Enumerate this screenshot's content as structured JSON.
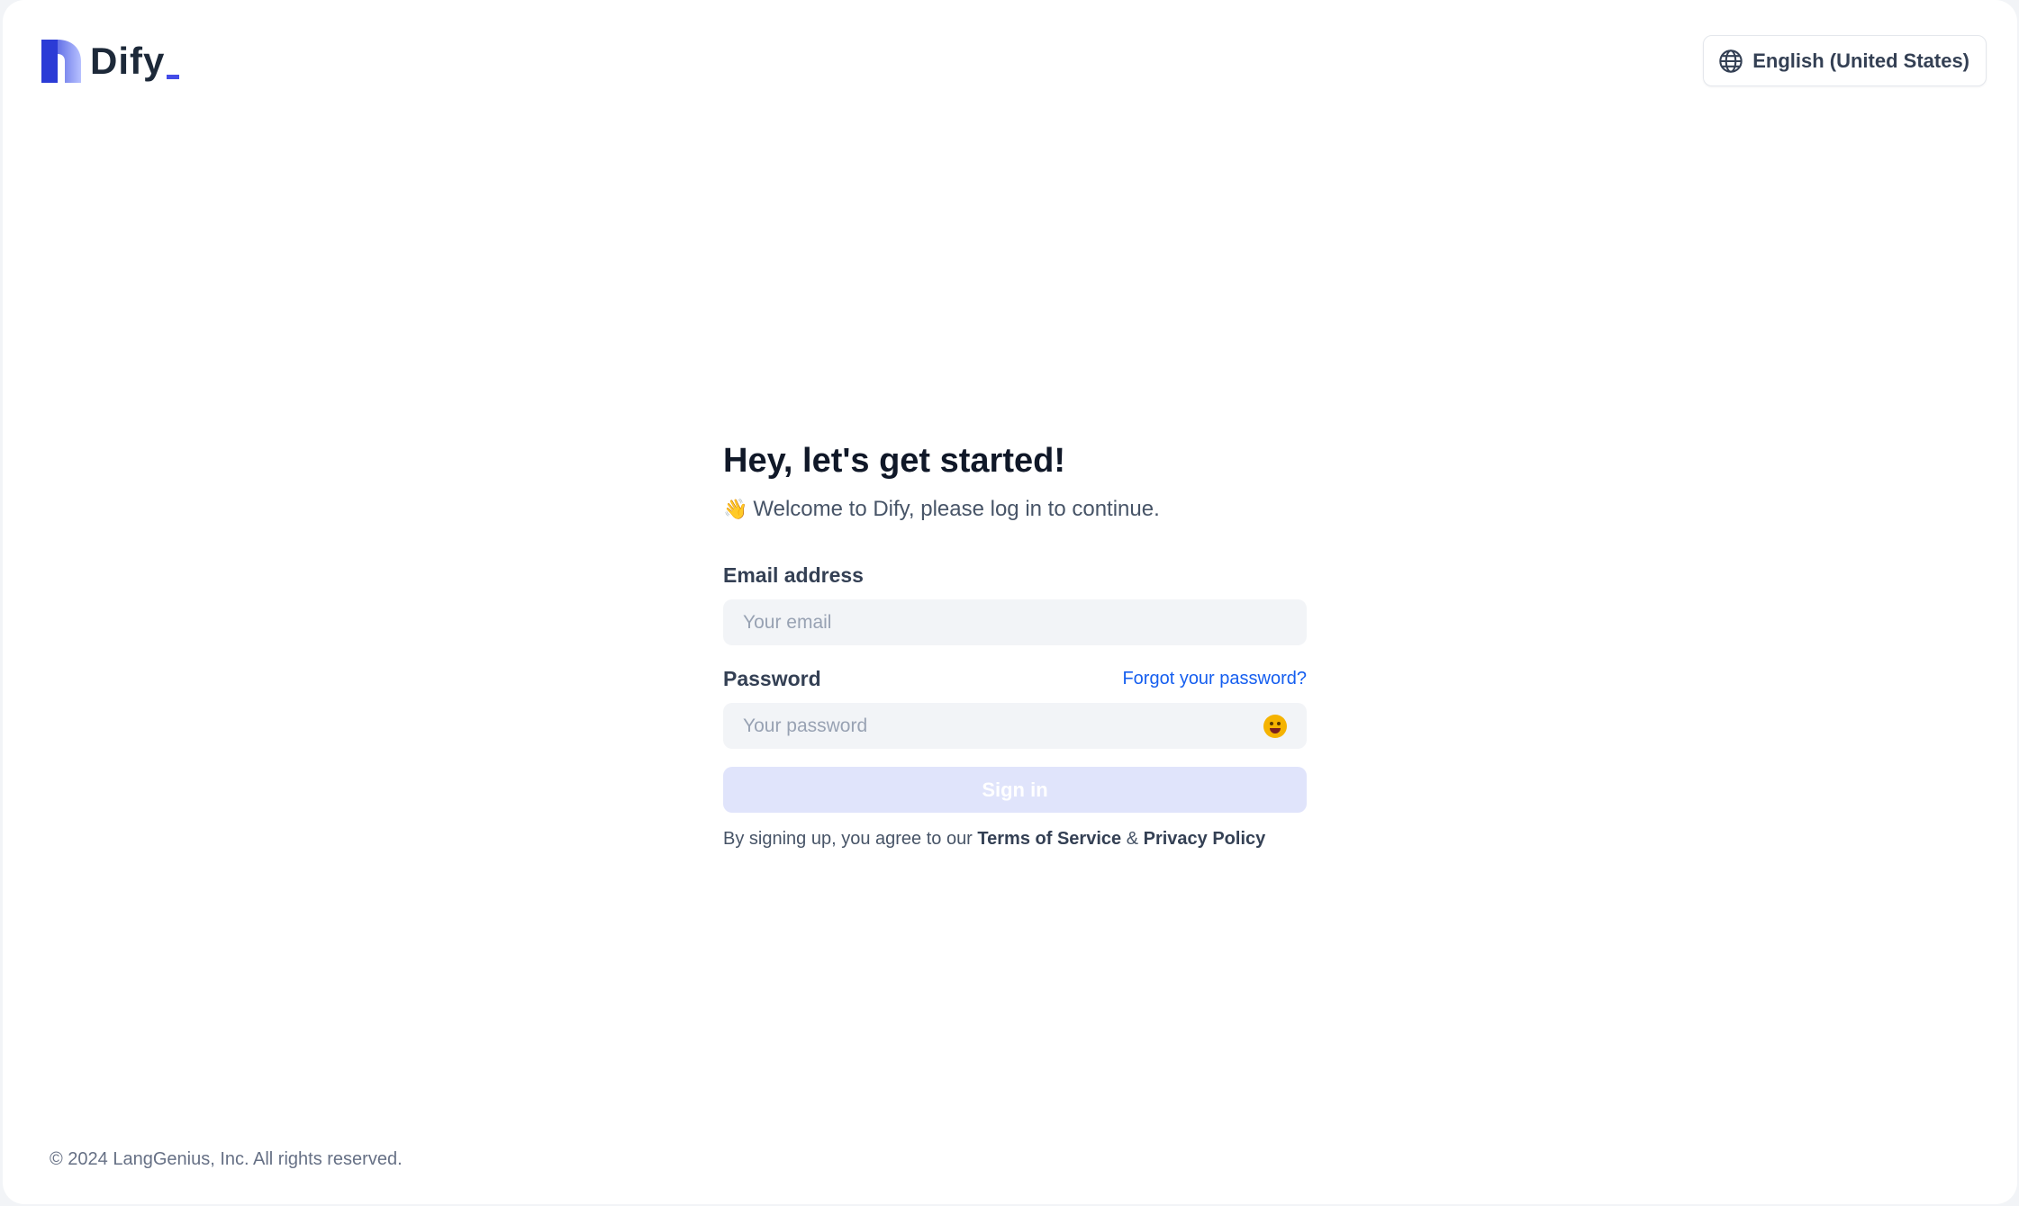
{
  "header": {
    "brand": "Dify",
    "language_label": "English (United States)"
  },
  "form": {
    "heading": "Hey, let's get started!",
    "wave_emoji": "👋",
    "subheading": "Welcome to Dify, please log in to continue.",
    "email_label": "Email address",
    "email_placeholder": "Your email",
    "password_label": "Password",
    "forgot_label": "Forgot your password?",
    "password_placeholder": "Your password",
    "signin_label": "Sign in",
    "terms_prefix": "By signing up, you agree to our",
    "terms_link": "Terms of Service",
    "terms_amp": "&",
    "privacy_link": "Privacy Policy"
  },
  "footer": {
    "copyright": "© 2024 LangGenius, Inc. All rights reserved."
  },
  "colors": {
    "accent": "#155eef",
    "brand": "#444ce7",
    "signin_disabled_bg": "#e0e4fb"
  },
  "icons": {
    "logo": "dify-logo-icon",
    "language": "globe-icon",
    "password_toggle": "emoji-eye-icon"
  }
}
